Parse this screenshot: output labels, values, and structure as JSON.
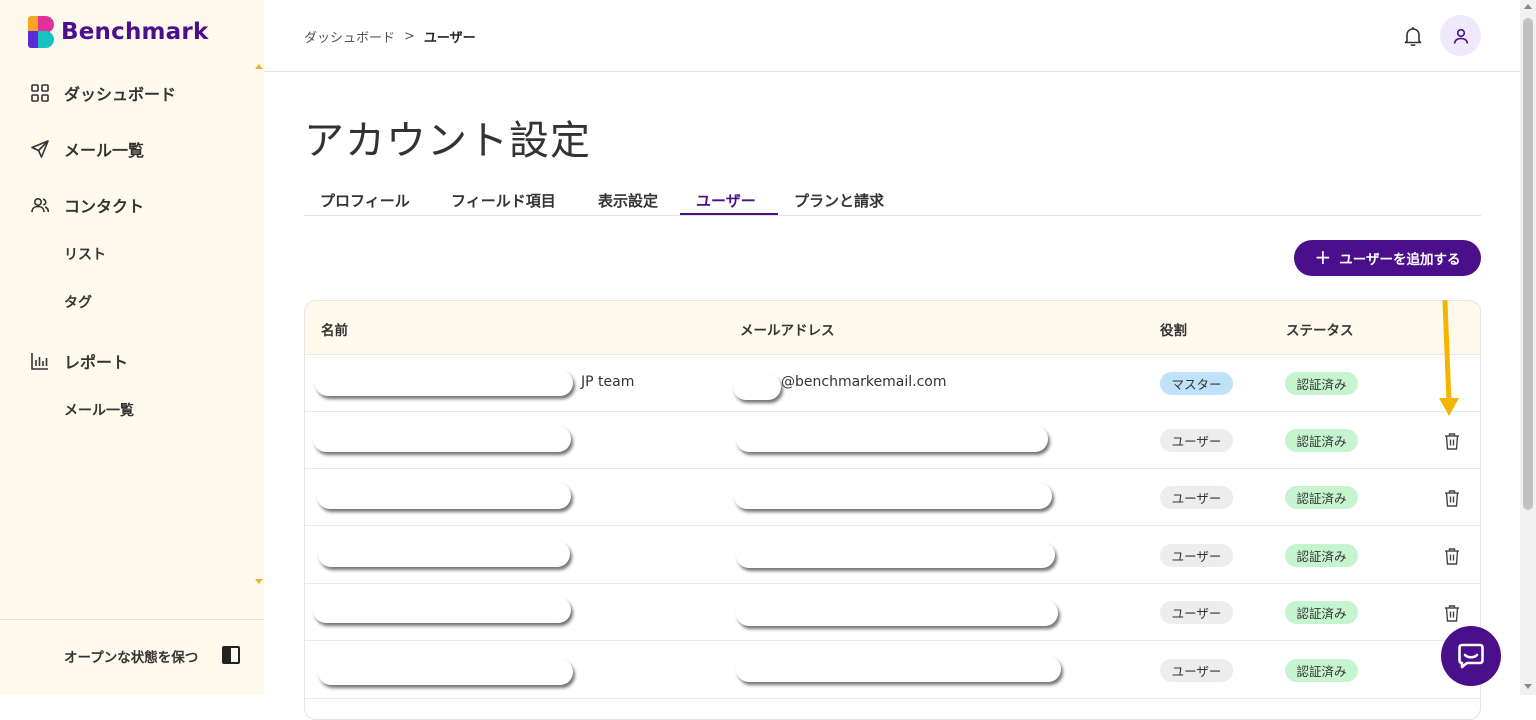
{
  "brand": {
    "name": "Benchmark"
  },
  "sidebar": {
    "items": [
      {
        "label": "ダッシュボード",
        "icon": "dashboard-grid-icon"
      },
      {
        "label": "メール一覧",
        "icon": "send-icon"
      },
      {
        "label": "コンタクト",
        "icon": "contacts-icon"
      },
      {
        "label": "リスト"
      },
      {
        "label": "タグ"
      },
      {
        "label": "レポート",
        "icon": "bar-chart-icon"
      },
      {
        "label": "メール一覧"
      }
    ],
    "footer": {
      "keep_open_label": "オープンな状態を保つ",
      "icon": "panel-toggle-icon"
    }
  },
  "header": {
    "breadcrumb": {
      "parent": "ダッシュボード",
      "separator": ">",
      "current": "ユーザー"
    },
    "icons": [
      "bell-icon",
      "user-avatar-icon"
    ]
  },
  "page": {
    "title": "アカウント設定",
    "tabs": [
      {
        "label": "プロフィール"
      },
      {
        "label": "フィールド項目"
      },
      {
        "label": "表示設定"
      },
      {
        "label": "ユーザー",
        "active": true
      },
      {
        "label": "プランと請求"
      }
    ],
    "add_user_button": "ユーザーを追加する"
  },
  "table": {
    "columns": {
      "name": "名前",
      "email": "メールアドレス",
      "role": "役割",
      "status": "ステータス"
    },
    "rows": [
      {
        "name_suffix": "JP team",
        "email_suffix": "@benchmarkemail.com",
        "role": "マスター",
        "status": "認証済み"
      },
      {
        "role": "ユーザー",
        "status": "認証済み"
      },
      {
        "role": "ユーザー",
        "status": "認証済み"
      },
      {
        "role": "ユーザー",
        "status": "認証済み"
      },
      {
        "role": "ユーザー",
        "status": "認証済み"
      },
      {
        "role": "ユーザー",
        "status": "認証済み"
      }
    ]
  },
  "colors": {
    "brand_purple": "#4b0f8c",
    "sidebar_bg": "#fdf9ec",
    "status_green": "#c6f4cf",
    "master_blue": "#bfe2f9",
    "arrow_annotation": "#f5b400"
  }
}
